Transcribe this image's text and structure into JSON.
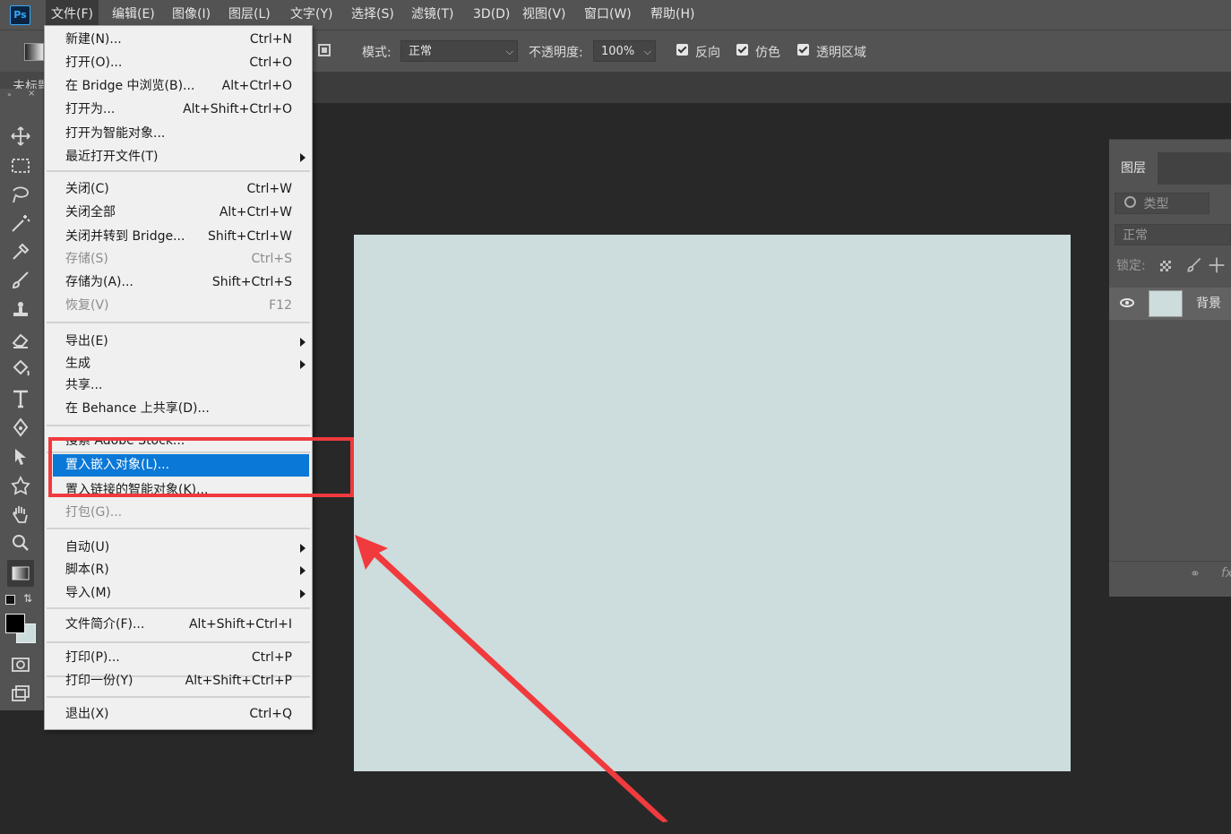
{
  "app": {
    "logo": "Ps"
  },
  "menubar": {
    "items": [
      "文件(F)",
      "编辑(E)",
      "图像(I)",
      "图层(L)",
      "文字(Y)",
      "选择(S)",
      "滤镜(T)",
      "3D(D)",
      "视图(V)",
      "窗口(W)",
      "帮助(H)"
    ],
    "active_index": 0
  },
  "options_bar": {
    "mode_label": "模式:",
    "mode_value": "正常",
    "opacity_label": "不透明度:",
    "opacity_value": "100%",
    "checkboxes": [
      {
        "label": "反向",
        "checked": true
      },
      {
        "label": "仿色",
        "checked": true
      },
      {
        "label": "透明区域",
        "checked": true
      }
    ]
  },
  "document_tab": {
    "title": "未标题"
  },
  "toolbar": {
    "header": "»",
    "close": "×"
  },
  "file_menu": {
    "items": [
      {
        "label": "新建(N)...",
        "shortcut": "Ctrl+N"
      },
      {
        "label": "打开(O)...",
        "shortcut": "Ctrl+O"
      },
      {
        "label": "在 Bridge 中浏览(B)...",
        "shortcut": "Alt+Ctrl+O"
      },
      {
        "label": "打开为...",
        "shortcut": "Alt+Shift+Ctrl+O"
      },
      {
        "label": "打开为智能对象...",
        "shortcut": ""
      },
      {
        "label": "最近打开文件(T)",
        "shortcut": ""
      },
      {
        "label": "关闭(C)",
        "shortcut": "Ctrl+W"
      },
      {
        "label": "关闭全部",
        "shortcut": "Alt+Ctrl+W"
      },
      {
        "label": "关闭并转到 Bridge...",
        "shortcut": "Shift+Ctrl+W"
      },
      {
        "label": "存储(S)",
        "shortcut": "Ctrl+S"
      },
      {
        "label": "存储为(A)...",
        "shortcut": "Shift+Ctrl+S"
      },
      {
        "label": "恢复(V)",
        "shortcut": "F12"
      },
      {
        "label": "导出(E)",
        "shortcut": ""
      },
      {
        "label": "生成",
        "shortcut": ""
      },
      {
        "label": "共享...",
        "shortcut": ""
      },
      {
        "label": "在 Behance 上共享(D)...",
        "shortcut": ""
      },
      {
        "label": "搜索 Adobe Stock...",
        "shortcut": ""
      },
      {
        "label": "置入嵌入对象(L)...",
        "shortcut": ""
      },
      {
        "label": "置入链接的智能对象(K)...",
        "shortcut": ""
      },
      {
        "label": "打包(G)...",
        "shortcut": ""
      },
      {
        "label": "自动(U)",
        "shortcut": ""
      },
      {
        "label": "脚本(R)",
        "shortcut": ""
      },
      {
        "label": "导入(M)",
        "shortcut": ""
      },
      {
        "label": "文件简介(F)...",
        "shortcut": "Alt+Shift+Ctrl+I"
      },
      {
        "label": "打印(P)...",
        "shortcut": "Ctrl+P"
      },
      {
        "label": "打印一份(Y)",
        "shortcut": "Alt+Shift+Ctrl+P"
      },
      {
        "label": "退出(X)",
        "shortcut": "Ctrl+Q"
      }
    ],
    "highlighted_index": 17
  },
  "layers_panel": {
    "tab_label": "图层",
    "filter_placeholder": "类型",
    "blend_mode": "正常",
    "lock_label": "锁定:",
    "layers": [
      {
        "name": "背景",
        "visible": true
      }
    ],
    "bottom_fx": "fx"
  },
  "colors": {
    "menu_highlight": "#0a78d7",
    "annotation_red": "#f03a3d",
    "canvas_fill": "#cddcdc",
    "ui_panel": "#535353",
    "workspace": "#282828"
  }
}
